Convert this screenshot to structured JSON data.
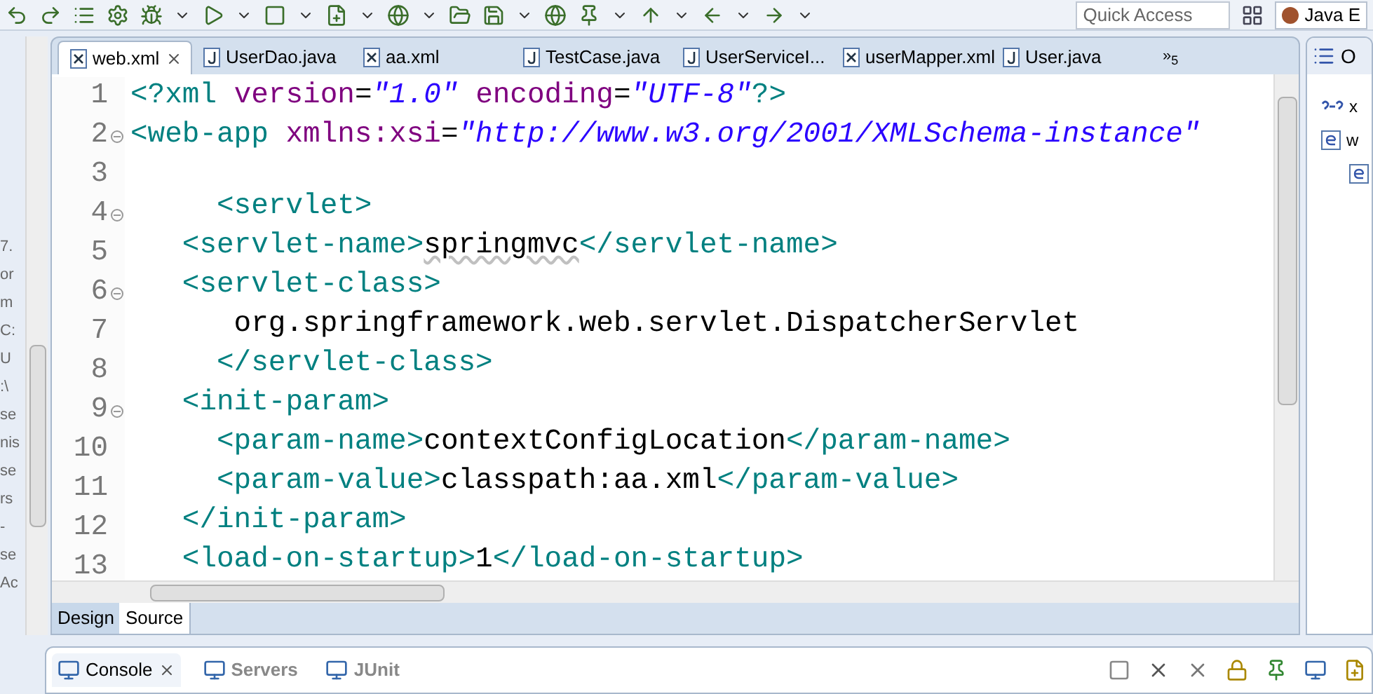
{
  "toolbar": {
    "quick_access": {
      "placeholder": "Quick Access"
    },
    "perspective": "Java E"
  },
  "left_strip": {
    "fragments": [
      "7.",
      "or",
      "m",
      "C:",
      "U",
      ":\\",
      "se",
      "nis",
      "se",
      "rs",
      "-",
      "se",
      "Ac"
    ]
  },
  "editor_tabs": [
    {
      "label": "web.xml",
      "kind": "xml",
      "selected": true,
      "closable": true
    },
    {
      "label": "UserDao.java",
      "kind": "java",
      "selected": false,
      "closable": false
    },
    {
      "label": "aa.xml",
      "kind": "xml",
      "selected": false,
      "closable": false
    },
    {
      "label": "TestCase.java",
      "kind": "java",
      "selected": false,
      "closable": false
    },
    {
      "label": "UserServiceI...",
      "kind": "java",
      "selected": false,
      "closable": false
    },
    {
      "label": "userMapper.xml",
      "kind": "xml",
      "selected": false,
      "closable": false
    },
    {
      "label": "User.java",
      "kind": "java",
      "selected": false,
      "closable": false
    }
  ],
  "overflow": {
    "symbol": "»",
    "count": "5"
  },
  "code_lines": [
    {
      "number": "1",
      "fold": false,
      "segments": [
        {
          "kind": "tag",
          "text": "<?xml "
        },
        {
          "kind": "attr",
          "text": "version"
        },
        {
          "kind": "text",
          "text": "="
        },
        {
          "kind": "value",
          "text": "\"1.0\""
        },
        {
          "kind": "attr",
          "text": " encoding"
        },
        {
          "kind": "text",
          "text": "="
        },
        {
          "kind": "value",
          "text": "\"UTF-8\""
        },
        {
          "kind": "tag",
          "text": "?>"
        }
      ]
    },
    {
      "number": "2",
      "fold": true,
      "segments": [
        {
          "kind": "tag",
          "text": "<web-app "
        },
        {
          "kind": "attr",
          "text": "xmlns:xsi"
        },
        {
          "kind": "text",
          "text": "="
        },
        {
          "kind": "value",
          "text": "\"http://www.w3.org/2001/XMLSchema-instance\""
        }
      ]
    },
    {
      "number": "3",
      "fold": false
    },
    {
      "number": "4",
      "fold": true,
      "segments": [
        {
          "kind": "tag",
          "text": "     <servlet>"
        }
      ]
    },
    {
      "number": "5",
      "fold": false,
      "segments": [
        {
          "kind": "tag",
          "text": "   <servlet-name>"
        },
        {
          "kind": "misspelled",
          "text": "springmvc"
        },
        {
          "kind": "tag",
          "text": "</servlet-name>"
        }
      ]
    },
    {
      "number": "6",
      "fold": true,
      "segments": [
        {
          "kind": "tag",
          "text": "   <servlet-class>"
        }
      ]
    },
    {
      "number": "7",
      "fold": false,
      "segments": [
        {
          "kind": "text",
          "text": "      org.springframework.web.servlet.DispatcherServlet"
        }
      ]
    },
    {
      "number": "8",
      "fold": false,
      "segments": [
        {
          "kind": "tag",
          "text": "     </servlet-class>"
        }
      ]
    },
    {
      "number": "9",
      "fold": true,
      "segments": [
        {
          "kind": "tag",
          "text": "   <init-param>"
        }
      ]
    },
    {
      "number": "10",
      "fold": false,
      "segments": [
        {
          "kind": "tag",
          "text": "     <param-name>"
        },
        {
          "kind": "text",
          "text": "contextConfigLocation"
        },
        {
          "kind": "tag",
          "text": "</param-name>"
        }
      ]
    },
    {
      "number": "11",
      "fold": false,
      "segments": [
        {
          "kind": "tag",
          "text": "     <param-value>"
        },
        {
          "kind": "text",
          "text": "classpath:aa.xml"
        },
        {
          "kind": "tag",
          "text": "</param-value>"
        }
      ]
    },
    {
      "number": "12",
      "fold": false,
      "segments": [
        {
          "kind": "tag",
          "text": "   </init-param>"
        }
      ]
    },
    {
      "number": "13",
      "fold": false,
      "segments": [
        {
          "kind": "tag",
          "text": "   <load-on-startup>"
        },
        {
          "kind": "text",
          "text": "1"
        },
        {
          "kind": "tag",
          "text": "</load-on-startup>"
        }
      ]
    }
  ],
  "view_tabs": [
    {
      "label": "Design",
      "selected": false
    },
    {
      "label": "Source",
      "selected": true
    }
  ],
  "outline": {
    "title": "O",
    "items": [
      {
        "kind": "pi",
        "label": "x"
      },
      {
        "kind": "element",
        "label": "w",
        "children": [
          {
            "kind": "element"
          }
        ]
      }
    ]
  },
  "console_tabs": [
    {
      "label": "Console",
      "selected": true,
      "closable": true
    },
    {
      "label": "Servers",
      "selected": false,
      "closable": false
    },
    {
      "label": "JUnit",
      "selected": false,
      "closable": false
    }
  ]
}
